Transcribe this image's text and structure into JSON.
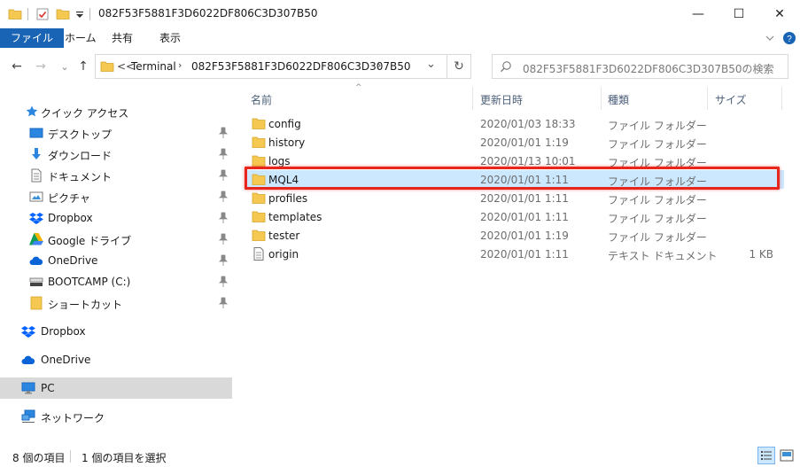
{
  "window": {
    "title": "082F53F5881F3D6022DF806C3D307B50",
    "minimize": "—",
    "maximize": "☐",
    "close": "✕"
  },
  "ribbon": {
    "tabs": [
      "ファイル",
      "ホーム",
      "共有",
      "表示"
    ]
  },
  "nav_buttons": {
    "back": "←",
    "forward": "→",
    "recent": "⌄",
    "up": "↑"
  },
  "address": {
    "overflow": "<<",
    "crumbs": [
      "Terminal",
      "082F53F5881F3D6022DF806C3D307B50"
    ],
    "separator": "›",
    "dropdown": "⌄",
    "refresh": "↻"
  },
  "search": {
    "placeholder": "082F53F5881F3D6022DF806C3D307B50の検索"
  },
  "sidebar": {
    "quick_access": "クイック アクセス",
    "items": [
      {
        "label": "デスクトップ",
        "icon": "desktop-icon",
        "pinned": true
      },
      {
        "label": "ダウンロード",
        "icon": "download-icon",
        "pinned": true
      },
      {
        "label": "ドキュメント",
        "icon": "document-icon",
        "pinned": true
      },
      {
        "label": "ピクチャ",
        "icon": "pictures-icon",
        "pinned": true
      },
      {
        "label": "Dropbox",
        "icon": "dropbox-icon",
        "pinned": true
      },
      {
        "label": "Google ドライブ",
        "icon": "google-drive-icon",
        "pinned": true
      },
      {
        "label": "OneDrive",
        "icon": "onedrive-icon",
        "pinned": true
      },
      {
        "label": "BOOTCAMP (C:)",
        "icon": "drive-icon",
        "pinned": true
      },
      {
        "label": "ショートカット",
        "icon": "folder-icon",
        "pinned": true
      }
    ],
    "roots": [
      {
        "label": "Dropbox",
        "icon": "dropbox-icon"
      },
      {
        "label": "OneDrive",
        "icon": "onedrive-icon"
      },
      {
        "label": "PC",
        "icon": "pc-icon",
        "selected": true
      },
      {
        "label": "ネットワーク",
        "icon": "network-icon"
      }
    ]
  },
  "columns": {
    "name": "名前",
    "date": "更新日時",
    "type": "種類",
    "size": "サイズ",
    "sort_indicator": "^"
  },
  "files": [
    {
      "name": "config",
      "date": "2020/01/03 18:33",
      "type": "ファイル フォルダー",
      "size": "",
      "kind": "folder"
    },
    {
      "name": "history",
      "date": "2020/01/01 1:19",
      "type": "ファイル フォルダー",
      "size": "",
      "kind": "folder"
    },
    {
      "name": "logs",
      "date": "2020/01/13 10:01",
      "type": "ファイル フォルダー",
      "size": "",
      "kind": "folder"
    },
    {
      "name": "MQL4",
      "date": "2020/01/01 1:11",
      "type": "ファイル フォルダー",
      "size": "",
      "kind": "folder",
      "selected": true
    },
    {
      "name": "profiles",
      "date": "2020/01/01 1:11",
      "type": "ファイル フォルダー",
      "size": "",
      "kind": "folder"
    },
    {
      "name": "templates",
      "date": "2020/01/01 1:11",
      "type": "ファイル フォルダー",
      "size": "",
      "kind": "folder"
    },
    {
      "name": "tester",
      "date": "2020/01/01 1:19",
      "type": "ファイル フォルダー",
      "size": "",
      "kind": "folder"
    },
    {
      "name": "origin",
      "date": "2020/01/01 1:11",
      "type": "テキスト ドキュメント",
      "size": "1 KB",
      "kind": "text"
    }
  ],
  "status": {
    "item_count": "8 個の項目",
    "selected": "1 個の項目を選択"
  },
  "colors": {
    "file_tab": "#1a64b6",
    "selection": "#cce8ff",
    "highlight_border": "#e8261b",
    "folder": "#f5c851"
  }
}
